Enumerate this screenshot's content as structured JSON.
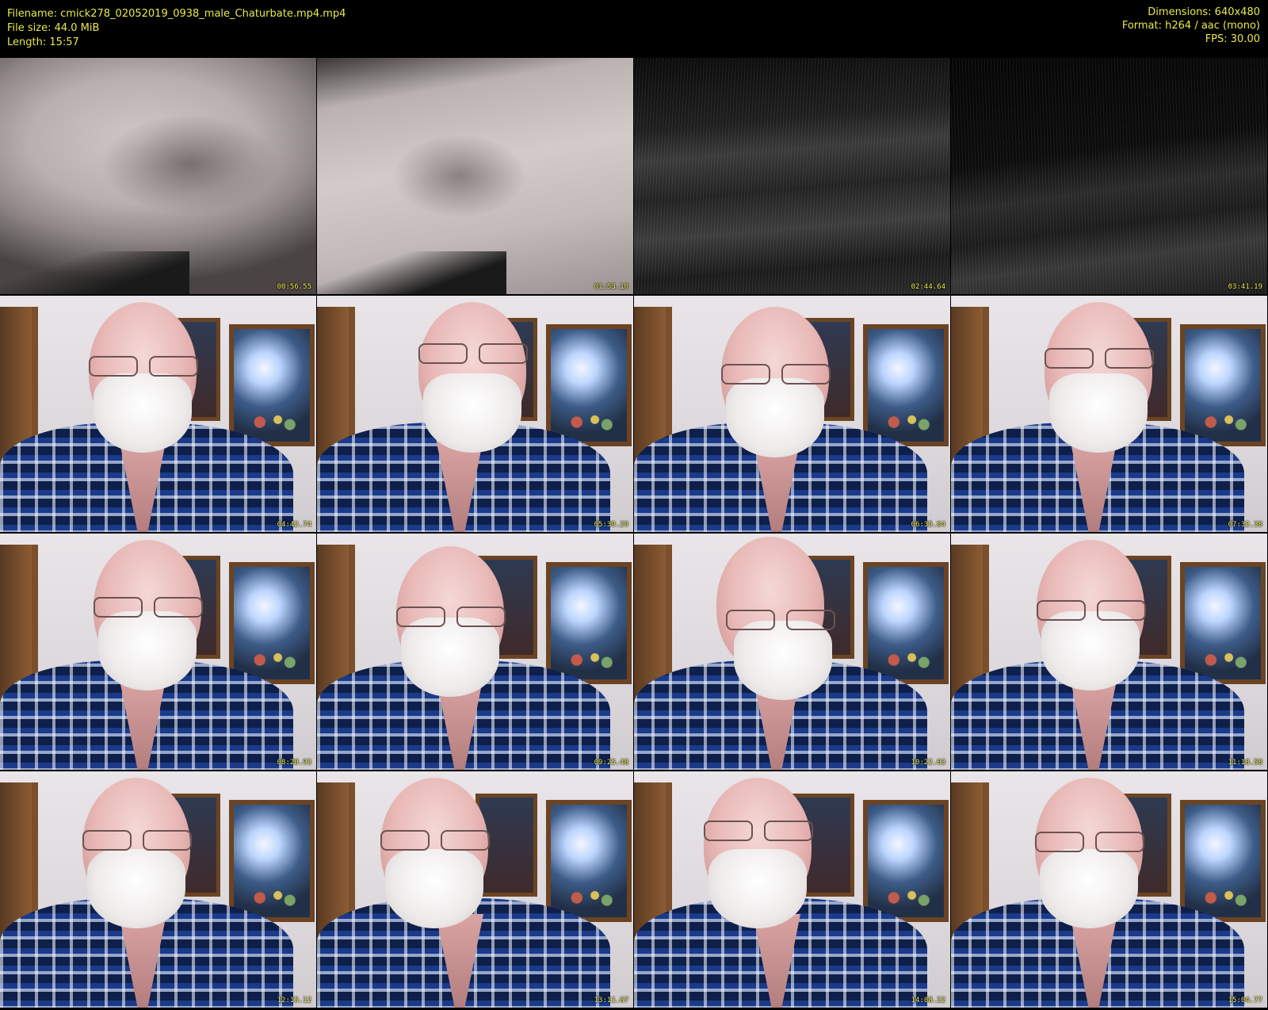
{
  "header": {
    "filename": "Filename: cmick278_02052019_0938_male_Chaturbate.mp4.mp4",
    "file_size": "File size: 44.0 MiB",
    "length": "Length: 15:57",
    "dimensions": "Dimensions: 640x480",
    "format": "Format: h264 / aac (mono)",
    "fps": "FPS: 30.00"
  },
  "colors": {
    "text": "#e8e84a",
    "background": "#000000"
  },
  "thumbnails": [
    {
      "timestamp": "00:56.55",
      "scene": "skin close-up"
    },
    {
      "timestamp": "01:53.10",
      "scene": "skin close-up"
    },
    {
      "timestamp": "02:44.64",
      "scene": "dark ribbed fabric"
    },
    {
      "timestamp": "03:41.19",
      "scene": "dark ribbed fabric"
    },
    {
      "timestamp": "04:42.74",
      "scene": "man in plaid shirt"
    },
    {
      "timestamp": "05:39.29",
      "scene": "man in plaid shirt"
    },
    {
      "timestamp": "06:35.84",
      "scene": "man in plaid shirt"
    },
    {
      "timestamp": "07:32.38",
      "scene": "man in plaid shirt"
    },
    {
      "timestamp": "08:28.93",
      "scene": "man in plaid shirt"
    },
    {
      "timestamp": "09:25.48",
      "scene": "man in plaid shirt"
    },
    {
      "timestamp": "10:22.03",
      "scene": "man in plaid shirt"
    },
    {
      "timestamp": "11:18.58",
      "scene": "man in plaid shirt"
    },
    {
      "timestamp": "12:15.12",
      "scene": "man in plaid shirt"
    },
    {
      "timestamp": "13:11.67",
      "scene": "man in plaid shirt"
    },
    {
      "timestamp": "14:08.22",
      "scene": "man in plaid shirt"
    },
    {
      "timestamp": "15:04.77",
      "scene": "man in plaid shirt"
    }
  ]
}
